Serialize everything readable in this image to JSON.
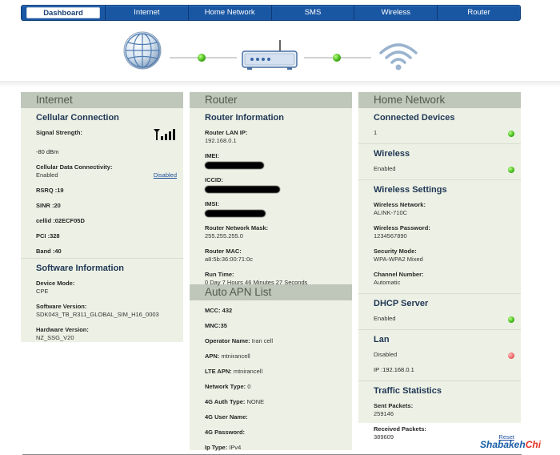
{
  "nav": {
    "tabs": [
      "Dashboard",
      "Internet",
      "Home Network",
      "SMS",
      "Wireless",
      "Router"
    ],
    "active": "Dashboard"
  },
  "colors": {
    "nav": "#1a57a3",
    "panel_bg": "#edf1e5",
    "panel_head": "#bfc7ba",
    "ok": "#40b817",
    "error": "#f06262"
  },
  "internet": {
    "header": "Internet",
    "cellular": {
      "title": "Cellular Connection",
      "signal_label": "Signal Strength:",
      "signal_value": "-80 dBm",
      "data_label": "Cellular Data Connectivity:",
      "data_value": "Enabled",
      "data_action": "Disabled",
      "rsrq": "RSRQ :19",
      "sinr": "SINR :20",
      "cellid": "cellid :02ECF05D",
      "pci": "PCI :328",
      "band": "Band :40"
    },
    "software": {
      "title": "Software Information",
      "device_mode_label": "Device Mode:",
      "device_mode_value": "CPE",
      "sw_version_label": "Software Version:",
      "sw_version_value": "SDK043_TB_R311_GLOBAL_SIM_H16_0003",
      "hw_version_label": "Hardware Version:",
      "hw_version_value": "NZ_SSG_V20"
    }
  },
  "router": {
    "header": "Router",
    "info": {
      "title": "Router Information",
      "lan_ip_label": "Router LAN IP:",
      "lan_ip_value": "192.168.0.1",
      "imei_label": "IMEI:",
      "iccid_label": "ICCID:",
      "imsi_label": "IMSI:",
      "mask_label": "Router Network Mask:",
      "mask_value": "255.255.255.0",
      "mac_label": "Router MAC:",
      "mac_value": "a8:5b:36:00:71:0c",
      "runtime_label": "Run Time:",
      "runtime_value": "0 Day 7 Hours 46 Minutes 27 Seconds"
    },
    "apn": {
      "header": "Auto APN List",
      "mcc": "MCC:  432",
      "mnc": "MNC:35",
      "operator_label": "Operator Name:",
      "operator_value": "Iran cell",
      "apn_label": "APN:",
      "apn_value": "mtnirancell",
      "lte_apn_label": "LTE APN:",
      "lte_apn_value": "mtnirancell",
      "nettype_label": "Network Type:",
      "nettype_value": "0",
      "auth_label": "4G Auth Type:",
      "auth_value": "NONE",
      "user_label": "4G User Name:",
      "pass_label": "4G Password:",
      "iptype_label": "Ip Type:",
      "iptype_value": "IPv4"
    }
  },
  "home": {
    "header": "Home Network",
    "devices": {
      "title": "Connected Devices",
      "value": "1"
    },
    "wireless": {
      "title": "Wireless",
      "value": "Enabled"
    },
    "wsettings": {
      "title": "Wireless Settings",
      "network_label": "Wireless Network:",
      "network_value": "ALINK-710C",
      "password_label": "Wireless Password:",
      "password_value": "1234567890",
      "security_label": "Security Mode:",
      "security_value": "WPA-WPA2 Mixed",
      "channel_label": "Channel Number:",
      "channel_value": "Automatic"
    },
    "dhcp": {
      "title": "DHCP Server",
      "value": "Enabled"
    },
    "lan": {
      "title": "Lan",
      "value": "Disabled",
      "ip": "IP :192.168.0.1"
    },
    "traffic": {
      "title": "Traffic Statistics",
      "sent_label": "Sent Packets:",
      "sent_value": "259146",
      "recv_label": "Received Packets:",
      "recv_value": "389609",
      "reset": "Reset"
    }
  },
  "brand": {
    "text": "Shabakeh",
    "accent": "Chi"
  }
}
